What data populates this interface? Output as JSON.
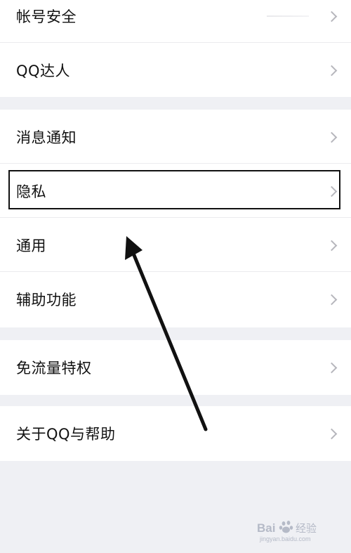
{
  "settings": {
    "group1": {
      "items": [
        {
          "label": "帐号安全"
        },
        {
          "label": "QQ达人"
        }
      ]
    },
    "group2": {
      "items": [
        {
          "label": "消息通知"
        },
        {
          "label": "隐私"
        },
        {
          "label": "通用"
        },
        {
          "label": "辅助功能"
        }
      ]
    },
    "group3": {
      "items": [
        {
          "label": "免流量特权"
        }
      ]
    },
    "group4": {
      "items": [
        {
          "label": "关于QQ与帮助"
        }
      ]
    }
  },
  "annotation": {
    "highlighted_item": "隐私",
    "highlight_color": "#111111",
    "arrow_color": "#111111"
  },
  "watermark": {
    "brand": "Baidu 经验",
    "url": "jingyan.baidu.com"
  },
  "colors": {
    "page_background": "#eff0f4",
    "group_background": "#ffffff",
    "label_color": "#111111",
    "chevron_color": "#b6b6bc"
  },
  "icons": {
    "row_chevron": "chevron-right-icon",
    "annotation_arrow": "arrow-up-left-icon",
    "watermark_logo": "baidu-paw-icon"
  }
}
